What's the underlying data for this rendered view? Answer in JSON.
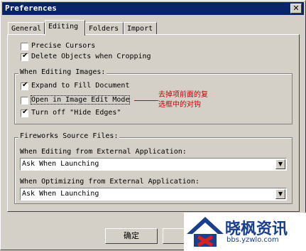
{
  "window": {
    "title": "Preferences",
    "close_glyph": "✕"
  },
  "tabs": [
    {
      "label": "General",
      "active": false
    },
    {
      "label": "Editing",
      "active": true
    },
    {
      "label": "Folders",
      "active": false
    },
    {
      "label": "Import",
      "active": false
    }
  ],
  "options": {
    "precise_cursors": {
      "label": "Precise Cursors",
      "checked": false
    },
    "delete_objects": {
      "label": "Delete Objects when Cropping",
      "checked": true
    }
  },
  "editing_images": {
    "title": "When Editing Images:",
    "items": [
      {
        "label": "Expand to Fill Document",
        "checked": true
      },
      {
        "label": "Open in Image Edit Mode",
        "checked": false
      },
      {
        "label": "Turn off \"Hide Edges\"",
        "checked": true
      }
    ]
  },
  "annotation": {
    "line1": "去掉项前面的复",
    "line2": "选框中的对钩",
    "color": "#cc0000"
  },
  "source_files": {
    "title": "Fireworks Source Files:",
    "editing_label": "When Editing from External Application:",
    "editing_value": "Ask When Launching",
    "optimizing_label": "When Optimizing from External Application:",
    "optimizing_value": "Ask When Launching"
  },
  "buttons": {
    "ok": "确定"
  },
  "watermark": {
    "name": "晓枫资讯",
    "url": "bbs.yzwlo.com",
    "logo_icon": "house-icon"
  }
}
